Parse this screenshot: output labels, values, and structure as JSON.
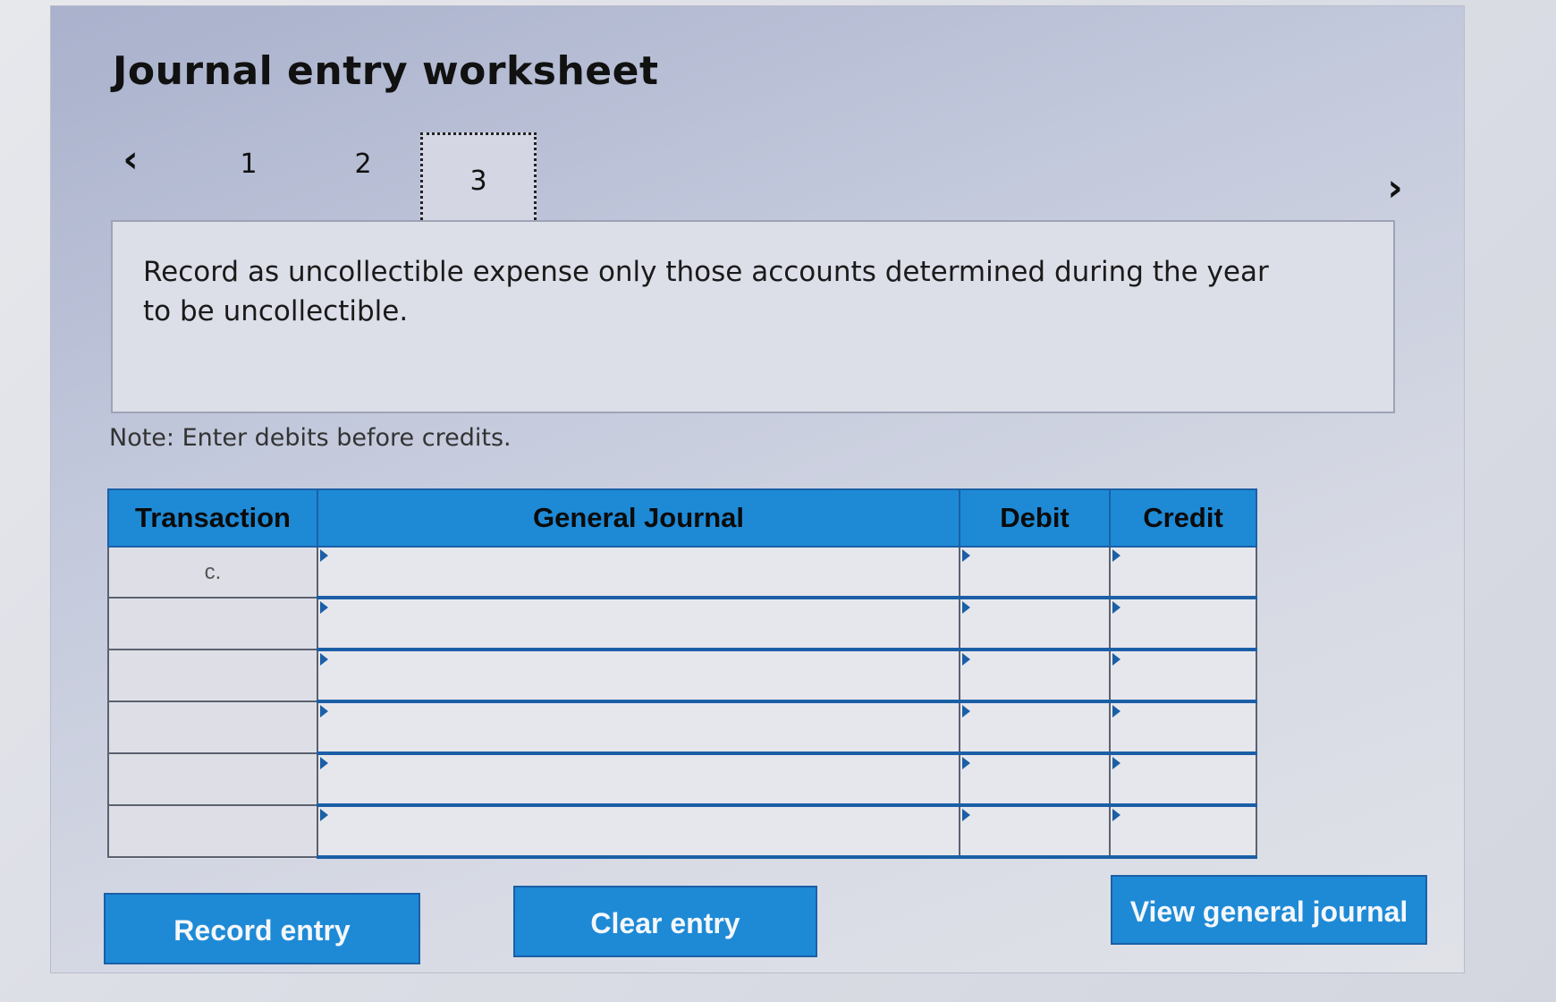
{
  "worksheet": {
    "title": "Journal entry worksheet"
  },
  "navigation": {
    "prev_icon": "chevron-left-icon",
    "next_icon": "chevron-right-icon",
    "prev_glyph": "‹",
    "next_glyph": "›",
    "steps": [
      {
        "label": "1",
        "active": false
      },
      {
        "label": "2",
        "active": false
      },
      {
        "label": "3",
        "active": true
      }
    ]
  },
  "instruction": {
    "text": "Record as uncollectible expense only those accounts determined during the year to be uncollectible."
  },
  "note": {
    "text": "Note: Enter debits before credits."
  },
  "table": {
    "headers": {
      "transaction": "Transaction",
      "general_journal": "General Journal",
      "debit": "Debit",
      "credit": "Credit"
    },
    "rows": [
      {
        "transaction": "c.",
        "general_journal": "",
        "debit": "",
        "credit": ""
      },
      {
        "transaction": "",
        "general_journal": "",
        "debit": "",
        "credit": ""
      },
      {
        "transaction": "",
        "general_journal": "",
        "debit": "",
        "credit": ""
      },
      {
        "transaction": "",
        "general_journal": "",
        "debit": "",
        "credit": ""
      },
      {
        "transaction": "",
        "general_journal": "",
        "debit": "",
        "credit": ""
      },
      {
        "transaction": "",
        "general_journal": "",
        "debit": "",
        "credit": ""
      }
    ]
  },
  "buttons": {
    "record_entry": "Record entry",
    "clear_entry": "Clear entry",
    "view_general_journal": "View general journal"
  },
  "colors": {
    "accent": "#1e8ad6",
    "accent_border": "#1b5fa6"
  }
}
